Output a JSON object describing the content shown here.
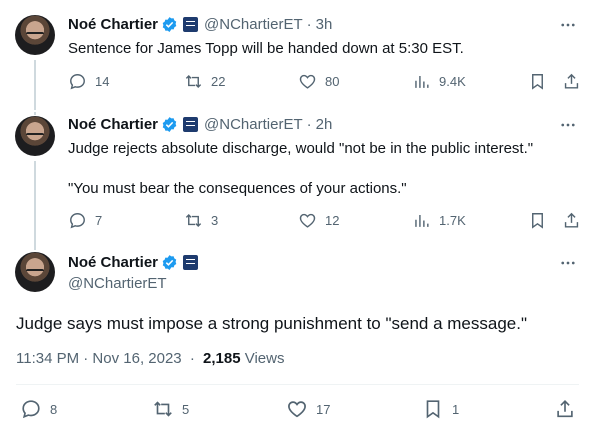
{
  "tweets": [
    {
      "name": "Noé Chartier",
      "handle": "@NChartierET",
      "time": "3h",
      "text_lines": [
        "Sentence for James Topp will be handed down at 5:30 EST."
      ],
      "replies": "14",
      "reposts": "22",
      "likes": "80",
      "views": "9.4K"
    },
    {
      "name": "Noé Chartier",
      "handle": "@NChartierET",
      "time": "2h",
      "text_lines": [
        "Judge rejects absolute discharge, would \"not be in the public interest.\"",
        "\"You must bear the consequences of your actions.\""
      ],
      "replies": "7",
      "reposts": "3",
      "likes": "12",
      "views": "1.7K"
    }
  ],
  "main": {
    "name": "Noé Chartier",
    "handle": "@NChartierET",
    "text": "Judge says must impose a strong punishment to \"send a message.\"",
    "timestamp": "11:34 PM · Nov 16, 2023",
    "views_count": "2,185",
    "views_label": "Views",
    "replies": "8",
    "reposts": "5",
    "likes": "17",
    "bookmarks": "1"
  },
  "separator": "·",
  "colors": {
    "accent": "#1d9bf0",
    "muted": "#536471",
    "text": "#0f1419",
    "line": "#cfd9de"
  }
}
